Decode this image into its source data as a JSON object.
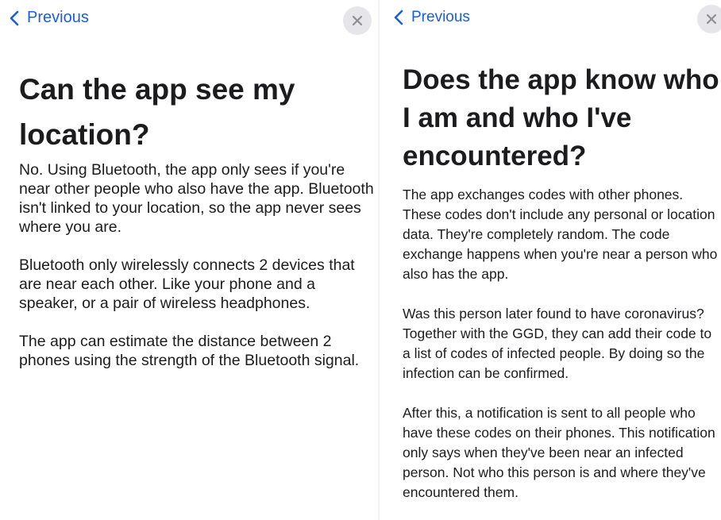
{
  "left": {
    "back_label": "Previous",
    "title": "Can the app see my location?",
    "paragraphs": [
      "No. Using Bluetooth, the app only sees if you're near other people who also have the app. Bluetooth isn't linked to your location, so the app never sees where you are.",
      "Bluetooth only wirelessly connects 2 devices that are near each other. Like your phone and a speaker, or a pair of wireless headphones.",
      "The app can estimate the distance between 2 phones using the strength of the Bluetooth signal."
    ]
  },
  "right": {
    "back_label": "Previous",
    "title": "Does the app know who I am and who I've encountered?",
    "paragraphs": [
      "The app exchanges codes with other phones. These codes don't include any personal or location data. They're completely random. The code exchange happens when you're near a person who also has the app.",
      "Was this person later found to have coronavirus? Together with the GGD, they can add their code to a list of codes of infected people. By doing so the infection can be confirmed.",
      "After this, a notification is sent to all people who have these codes on their phones. This notification only says when they've been near an infected person. Not who this person is and where they've encountered them."
    ]
  },
  "icons": {
    "back": "chevron-left-icon",
    "close": "close-icon"
  },
  "colors": {
    "accent": "#1a5fd6",
    "text": "#1c1c1e",
    "close_bg": "#e6e6ea",
    "close_glyph": "#8e8e93"
  }
}
